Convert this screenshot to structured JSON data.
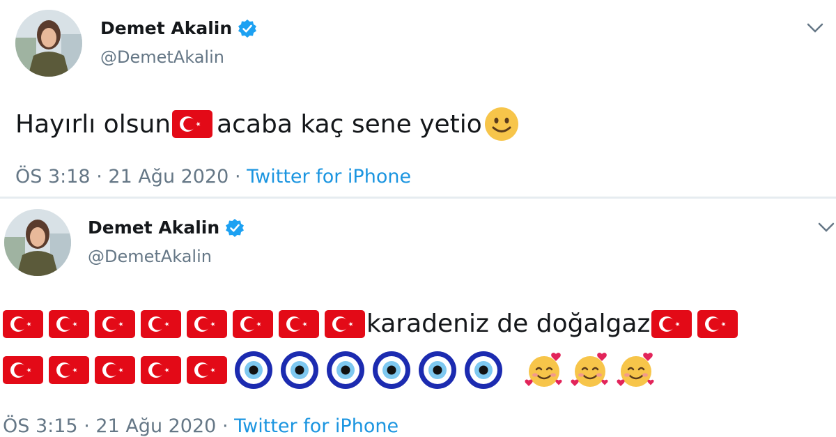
{
  "tweets": [
    {
      "author": {
        "name": "Demet Akalin",
        "handle": "@DemetAkalin"
      },
      "text_part1": "Hayırlı olsun",
      "text_part2": "acaba kaç sene yetio",
      "time": "ÖS 3:18",
      "separator1": "·",
      "date": "21 Ağu 2020",
      "separator2": "·",
      "source": "Twitter for iPhone"
    },
    {
      "author": {
        "name": "Demet Akalin",
        "handle": "@DemetAkalin"
      },
      "text": "karadeniz de doğalgaz",
      "time": "ÖS 3:15",
      "separator1": "·",
      "date": "21 Ağu 2020",
      "separator2": "·",
      "source": "Twitter for iPhone"
    }
  ],
  "icons": {
    "verified": "verified-badge-icon",
    "chevron": "chevron-down-icon",
    "flag": "turkish-flag-emoji",
    "eye": "nazar-amulet-emoji",
    "smile": "smiling-face-emoji",
    "love": "smiling-face-with-hearts-emoji"
  },
  "colors": {
    "name": "#14171a",
    "secondary": "#657786",
    "source_link": "#1b95e0",
    "verified": "#1da1f2",
    "flag": "#e30a17",
    "divider": "#e6ecf0"
  }
}
